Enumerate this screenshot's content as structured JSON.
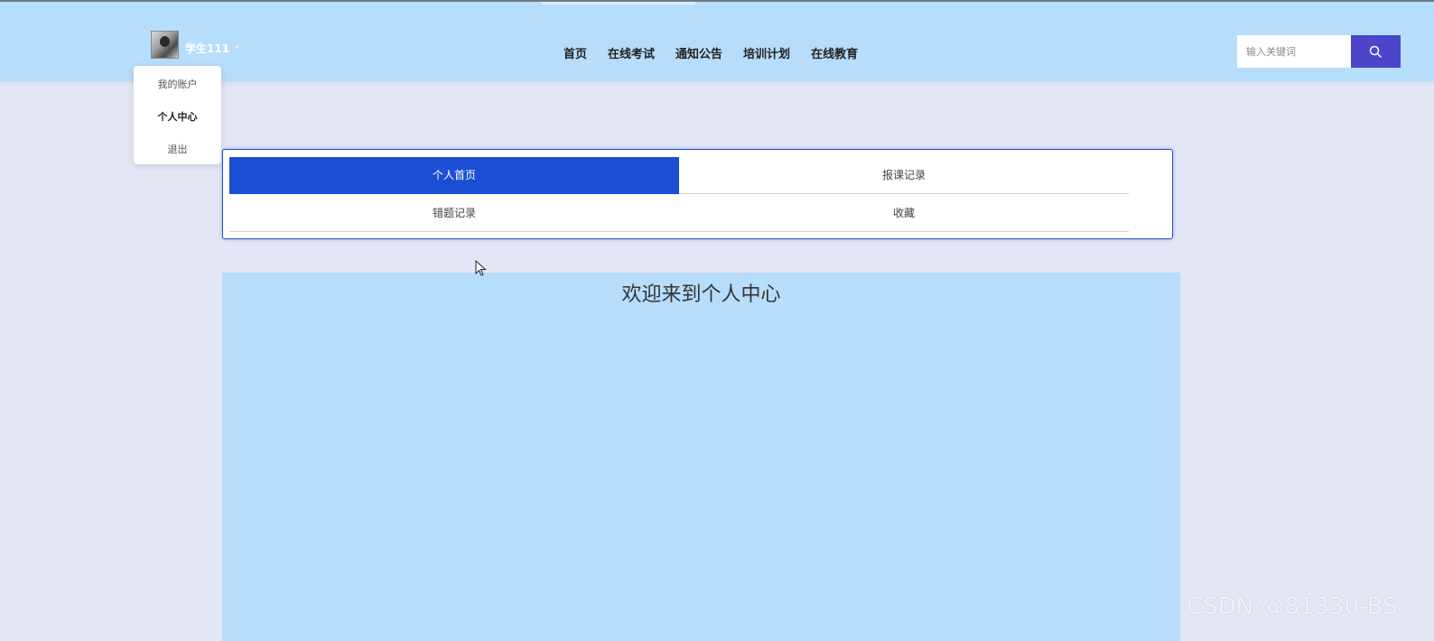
{
  "header": {
    "username": "学生111",
    "user_caret": "⌄",
    "nav": [
      "首页",
      "在线考试",
      "通知公告",
      "培训计划",
      "在线教育"
    ],
    "search": {
      "placeholder": "输入关键词",
      "value": ""
    }
  },
  "user_menu": {
    "items": [
      "我的账户",
      "个人中心",
      "退出"
    ],
    "active_index": 1
  },
  "tabs": {
    "items": [
      "个人首页",
      "报课记录",
      "错题记录",
      "收藏"
    ],
    "active_index": 0
  },
  "main": {
    "welcome": "欢迎来到个人中心"
  },
  "watermark": "CSDN @81330-BS",
  "colors": {
    "header_bg": "#b6ddfc",
    "page_bg": "#e3e6f5",
    "active_tab": "#1c4fd4",
    "search_button": "#4a45c9"
  }
}
